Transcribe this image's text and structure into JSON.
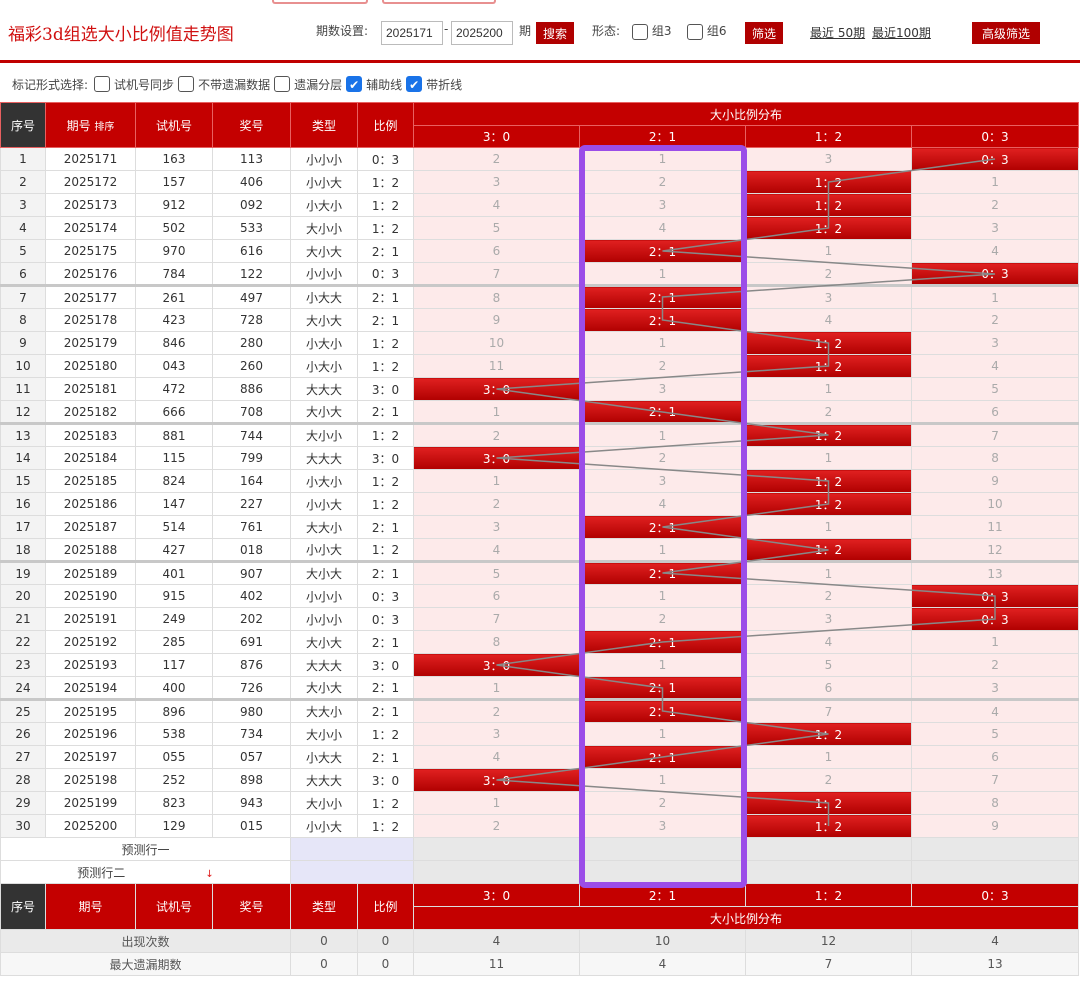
{
  "page_title": "福彩3d组选大小比例值走势图",
  "controls": {
    "period_label": "期数设置:",
    "period_from": "2025171",
    "dash": "-",
    "period_to": "2025200",
    "period_unit": "期",
    "search": "搜索",
    "form_label": "形态:",
    "group3": "组3",
    "group6": "组6",
    "filter": "筛选",
    "recent50": "最近 50期",
    "recent100": "最近100期",
    "advanced": "高级筛选"
  },
  "marks": {
    "label": "标记形式选择:",
    "options": [
      {
        "label": "试机号同步",
        "checked": false
      },
      {
        "label": "不带遗漏数据",
        "checked": false
      },
      {
        "label": "遗漏分层",
        "checked": false
      },
      {
        "label": "辅助线",
        "checked": true
      },
      {
        "label": "带折线",
        "checked": true
      }
    ]
  },
  "table": {
    "headers": {
      "seq": "序号",
      "period": "期号",
      "sort": "排序",
      "trial": "试机号",
      "prize": "奖号",
      "type": "类型",
      "ratio": "比例",
      "dist": "大小比例分布"
    },
    "ratios": [
      "3：0",
      "2：1",
      "1：2",
      "0：3"
    ],
    "rows": [
      {
        "seq": "1",
        "period": "2025171",
        "trial": "163",
        "prize": "113",
        "type": "小小小",
        "ratio": "0：3",
        "z": [
          "2",
          "1",
          "3",
          "0：3"
        ],
        "hit": 3
      },
      {
        "seq": "2",
        "period": "2025172",
        "trial": "157",
        "prize": "406",
        "type": "小小大",
        "ratio": "1：2",
        "z": [
          "3",
          "2",
          "1：2",
          "1"
        ],
        "hit": 2
      },
      {
        "seq": "3",
        "period": "2025173",
        "trial": "912",
        "prize": "092",
        "type": "小大小",
        "ratio": "1：2",
        "z": [
          "4",
          "3",
          "1：2",
          "2"
        ],
        "hit": 2
      },
      {
        "seq": "4",
        "period": "2025174",
        "trial": "502",
        "prize": "533",
        "type": "大小小",
        "ratio": "1：2",
        "z": [
          "5",
          "4",
          "1：2",
          "3"
        ],
        "hit": 2
      },
      {
        "seq": "5",
        "period": "2025175",
        "trial": "970",
        "prize": "616",
        "type": "大小大",
        "ratio": "2：1",
        "z": [
          "6",
          "2：1",
          "1",
          "4"
        ],
        "hit": 1
      },
      {
        "seq": "6",
        "period": "2025176",
        "trial": "784",
        "prize": "122",
        "type": "小小小",
        "ratio": "0：3",
        "z": [
          "7",
          "1",
          "2",
          "0：3"
        ],
        "hit": 3
      },
      {
        "seq": "7",
        "period": "2025177",
        "trial": "261",
        "prize": "497",
        "type": "小大大",
        "ratio": "2：1",
        "z": [
          "8",
          "2：1",
          "3",
          "1"
        ],
        "hit": 1
      },
      {
        "seq": "8",
        "period": "2025178",
        "trial": "423",
        "prize": "728",
        "type": "大小大",
        "ratio": "2：1",
        "z": [
          "9",
          "2：1",
          "4",
          "2"
        ],
        "hit": 1
      },
      {
        "seq": "9",
        "period": "2025179",
        "trial": "846",
        "prize": "280",
        "type": "小大小",
        "ratio": "1：2",
        "z": [
          "10",
          "1",
          "1：2",
          "3"
        ],
        "hit": 2
      },
      {
        "seq": "10",
        "period": "2025180",
        "trial": "043",
        "prize": "260",
        "type": "小大小",
        "ratio": "1：2",
        "z": [
          "11",
          "2",
          "1：2",
          "4"
        ],
        "hit": 2
      },
      {
        "seq": "11",
        "period": "2025181",
        "trial": "472",
        "prize": "886",
        "type": "大大大",
        "ratio": "3：0",
        "z": [
          "3：0",
          "3",
          "1",
          "5"
        ],
        "hit": 0
      },
      {
        "seq": "12",
        "period": "2025182",
        "trial": "666",
        "prize": "708",
        "type": "大小大",
        "ratio": "2：1",
        "z": [
          "1",
          "2：1",
          "2",
          "6"
        ],
        "hit": 1
      },
      {
        "seq": "13",
        "period": "2025183",
        "trial": "881",
        "prize": "744",
        "type": "大小小",
        "ratio": "1：2",
        "z": [
          "2",
          "1",
          "1：2",
          "7"
        ],
        "hit": 2
      },
      {
        "seq": "14",
        "period": "2025184",
        "trial": "115",
        "prize": "799",
        "type": "大大大",
        "ratio": "3：0",
        "z": [
          "3：0",
          "2",
          "1",
          "8"
        ],
        "hit": 0
      },
      {
        "seq": "15",
        "period": "2025185",
        "trial": "824",
        "prize": "164",
        "type": "小大小",
        "ratio": "1：2",
        "z": [
          "1",
          "3",
          "1：2",
          "9"
        ],
        "hit": 2
      },
      {
        "seq": "16",
        "period": "2025186",
        "trial": "147",
        "prize": "227",
        "type": "小小大",
        "ratio": "1：2",
        "z": [
          "2",
          "4",
          "1：2",
          "10"
        ],
        "hit": 2
      },
      {
        "seq": "17",
        "period": "2025187",
        "trial": "514",
        "prize": "761",
        "type": "大大小",
        "ratio": "2：1",
        "z": [
          "3",
          "2：1",
          "1",
          "11"
        ],
        "hit": 1
      },
      {
        "seq": "18",
        "period": "2025188",
        "trial": "427",
        "prize": "018",
        "type": "小小大",
        "ratio": "1：2",
        "z": [
          "4",
          "1",
          "1：2",
          "12"
        ],
        "hit": 2
      },
      {
        "seq": "19",
        "period": "2025189",
        "trial": "401",
        "prize": "907",
        "type": "大小大",
        "ratio": "2：1",
        "z": [
          "5",
          "2：1",
          "1",
          "13"
        ],
        "hit": 1
      },
      {
        "seq": "20",
        "period": "2025190",
        "trial": "915",
        "prize": "402",
        "type": "小小小",
        "ratio": "0：3",
        "z": [
          "6",
          "1",
          "2",
          "0：3"
        ],
        "hit": 3
      },
      {
        "seq": "21",
        "period": "2025191",
        "trial": "249",
        "prize": "202",
        "type": "小小小",
        "ratio": "0：3",
        "z": [
          "7",
          "2",
          "3",
          "0：3"
        ],
        "hit": 3
      },
      {
        "seq": "22",
        "period": "2025192",
        "trial": "285",
        "prize": "691",
        "type": "大小大",
        "ratio": "2：1",
        "z": [
          "8",
          "2：1",
          "4",
          "1"
        ],
        "hit": 1
      },
      {
        "seq": "23",
        "period": "2025193",
        "trial": "117",
        "prize": "876",
        "type": "大大大",
        "ratio": "3：0",
        "z": [
          "3：0",
          "1",
          "5",
          "2"
        ],
        "hit": 0
      },
      {
        "seq": "24",
        "period": "2025194",
        "trial": "400",
        "prize": "726",
        "type": "大小大",
        "ratio": "2：1",
        "z": [
          "1",
          "2：1",
          "6",
          "3"
        ],
        "hit": 1
      },
      {
        "seq": "25",
        "period": "2025195",
        "trial": "896",
        "prize": "980",
        "type": "大大小",
        "ratio": "2：1",
        "z": [
          "2",
          "2：1",
          "7",
          "4"
        ],
        "hit": 1
      },
      {
        "seq": "26",
        "period": "2025196",
        "trial": "538",
        "prize": "734",
        "type": "大小小",
        "ratio": "1：2",
        "z": [
          "3",
          "1",
          "1：2",
          "5"
        ],
        "hit": 2
      },
      {
        "seq": "27",
        "period": "2025197",
        "trial": "055",
        "prize": "057",
        "type": "小大大",
        "ratio": "2：1",
        "z": [
          "4",
          "2：1",
          "1",
          "6"
        ],
        "hit": 1
      },
      {
        "seq": "28",
        "period": "2025198",
        "trial": "252",
        "prize": "898",
        "type": "大大大",
        "ratio": "3：0",
        "z": [
          "3：0",
          "1",
          "2",
          "7"
        ],
        "hit": 0
      },
      {
        "seq": "29",
        "period": "2025199",
        "trial": "823",
        "prize": "943",
        "type": "大小小",
        "ratio": "1：2",
        "z": [
          "1",
          "2",
          "1：2",
          "8"
        ],
        "hit": 2
      },
      {
        "seq": "30",
        "period": "2025200",
        "trial": "129",
        "prize": "015",
        "type": "小小大",
        "ratio": "1：2",
        "z": [
          "2",
          "3",
          "1：2",
          "9"
        ],
        "hit": 2
      }
    ],
    "predict1": "预测行一",
    "predict2": "预测行二",
    "stats": [
      {
        "label": "出现次数",
        "type": "0",
        "ratio": "0",
        "vals": [
          "4",
          "10",
          "12",
          "4"
        ]
      },
      {
        "label": "最大遗漏期数",
        "type": "0",
        "ratio": "0",
        "vals": [
          "11",
          "4",
          "7",
          "13"
        ]
      }
    ]
  },
  "colors": {
    "accent": "#c40000",
    "highlight": "#9b4de8"
  }
}
